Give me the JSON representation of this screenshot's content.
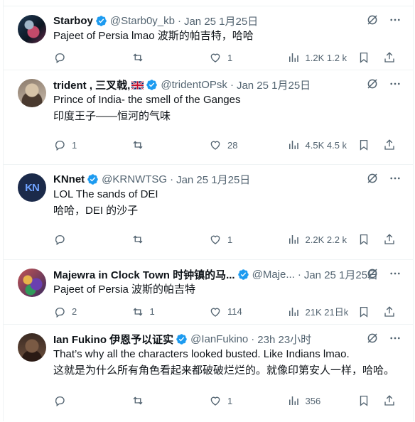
{
  "tweets": [
    {
      "name": "Starboy",
      "handle": "@Starb0y_kb",
      "time": "Jan 25 1月25日",
      "lines": [
        "Pajeet of Persia lmao  波斯的帕吉特，哈哈"
      ],
      "replies": "",
      "reposts": "",
      "likes": "1",
      "views": "1.2K 1.2 k"
    },
    {
      "name": "trident , 三叉戟,",
      "handle": "@tridentOPsk",
      "time": "Jan 25 1月25日",
      "lines": [
        "Prince of India- the smell of the Ganges",
        "印度王子——恒河的气味"
      ],
      "replies": "1",
      "reposts": "",
      "likes": "28",
      "views": "4.5K 4.5 k"
    },
    {
      "name": "KNnet",
      "handle": "@KRNWTSG",
      "time": "Jan 25 1月25日",
      "lines": [
        "LOL The sands of DEI",
        "哈哈，DEI 的沙子"
      ],
      "replies": "",
      "reposts": "",
      "likes": "1",
      "views": "2.2K 2.2 k"
    },
    {
      "name": "Majewra in Clock Town 时钟镇的马...",
      "handle": "@Maje...",
      "time": "Jan 25 1月25日",
      "lines": [
        "Pajeet of Persia  波斯的帕吉特"
      ],
      "replies": "2",
      "reposts": "1",
      "likes": "114",
      "views": "21K 21日k"
    },
    {
      "name": "Ian Fukino 伊恩予以证实",
      "handle": "@IanFukino",
      "time": "23h 23小时",
      "lines": [
        "That’s why all the characters looked busted. Like Indians lmao.",
        "这就是为什么所有角色看起来都破破烂烂的。就像印第安人一样，哈哈。"
      ],
      "replies": "",
      "reposts": "",
      "likes": "1",
      "views": "356"
    }
  ],
  "avatars": [
    "space-hero-avatar",
    "man-portrait-avatar",
    "kn-logo-avatar",
    "colorful-art-avatar",
    "man-portrait-dark-avatar"
  ],
  "avatar_3_text": "KN",
  "icons": {
    "verified_color": "#1d9bf0",
    "muted_color": "#536471",
    "verified": "verified-badge-icon",
    "flag": "uk-flag-icon",
    "grok": "grok-icon",
    "more": "more-icon",
    "reply": "reply-icon",
    "repost": "repost-icon",
    "like": "heart-icon",
    "views": "views-icon",
    "bookmark": "bookmark-icon",
    "share": "share-icon"
  }
}
